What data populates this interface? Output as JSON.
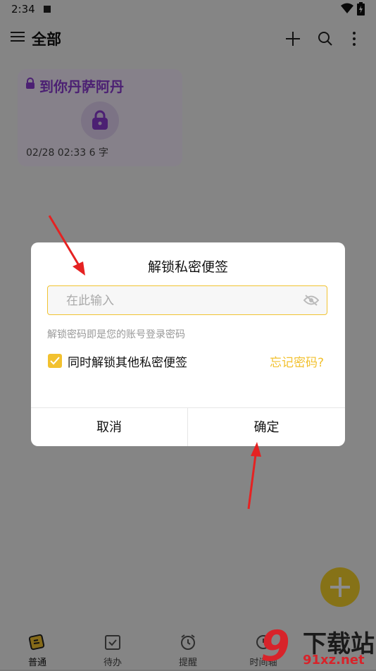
{
  "status": {
    "time": "2:34"
  },
  "appbar": {
    "title": "全部"
  },
  "note": {
    "title": "到你丹萨阿丹",
    "meta": "02/28 02:33  6 字"
  },
  "nav": [
    {
      "label": "普通",
      "icon": "note-icon"
    },
    {
      "label": "待办",
      "icon": "todo-icon"
    },
    {
      "label": "提醒",
      "icon": "alarm-icon"
    },
    {
      "label": "时间轴",
      "icon": "timeline-icon"
    }
  ],
  "dialog": {
    "title": "解锁私密便签",
    "input_placeholder": "在此输入",
    "input_value": "",
    "hint": "解锁密码即是您的账号登录密码",
    "checkbox_label": "同时解锁其他私密便签",
    "checkbox_checked": true,
    "forgot_label": "忘记密码?",
    "cancel_label": "取消",
    "ok_label": "确定"
  },
  "watermark": {
    "top": "下载站",
    "bottom": "91xz.net",
    "mark": "9"
  },
  "colors": {
    "accent": "#f2c12f",
    "note_title": "#8a3bd1",
    "arrow": "#e52222",
    "watermark_red": "#d8232a"
  }
}
